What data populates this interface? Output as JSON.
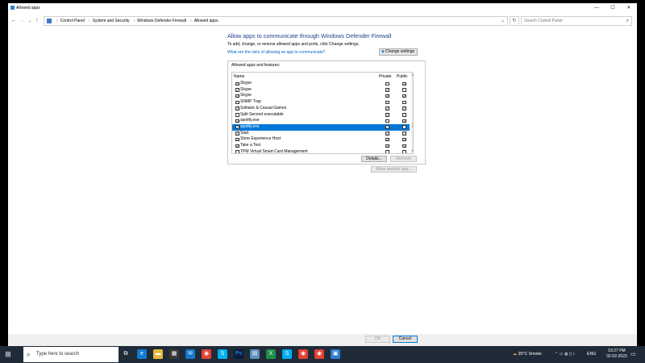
{
  "window": {
    "title": "Allowed apps",
    "minimize": "—",
    "maximize": "☐",
    "close": "✕"
  },
  "address": {
    "breadcrumbs": [
      "Control Panel",
      "Windows Defender Firewall",
      "Allowed apps"
    ],
    "breadcrumb_mid": "System and Security",
    "search_placeholder": "Search Control Panel"
  },
  "main": {
    "heading": "Allow apps to communicate through Windows Defender Firewall",
    "instructions": "To add, change, or remove allowed apps and ports, click Change settings.",
    "risk_link": "What are the risks of allowing an app to communicate?",
    "change_settings": "Change settings",
    "group_title": "Allowed apps and features:",
    "columns": {
      "name": "Name",
      "private": "Private",
      "public": "Public"
    },
    "rows": [
      {
        "name": "Skype",
        "checked": true,
        "private": false,
        "public": true,
        "selected": false
      },
      {
        "name": "Skype",
        "checked": true,
        "private": true,
        "public": false,
        "selected": false
      },
      {
        "name": "Skype",
        "checked": true,
        "private": true,
        "public": true,
        "selected": false
      },
      {
        "name": "SNMP Trap",
        "checked": false,
        "private": false,
        "public": false,
        "selected": false
      },
      {
        "name": "Solitaire & Casual Games",
        "checked": true,
        "private": true,
        "public": true,
        "selected": false
      },
      {
        "name": "Split Second executable",
        "checked": false,
        "private": true,
        "public": false,
        "selected": false
      },
      {
        "name": "spotify.exe",
        "checked": true,
        "private": false,
        "public": true,
        "selected": false
      },
      {
        "name": "spotify.exe",
        "checked": true,
        "private": true,
        "public": false,
        "selected": true
      },
      {
        "name": "Start",
        "checked": true,
        "private": true,
        "public": true,
        "selected": false
      },
      {
        "name": "Store Experience Host",
        "checked": true,
        "private": true,
        "public": true,
        "selected": false
      },
      {
        "name": "Take a Test",
        "checked": true,
        "private": true,
        "public": true,
        "selected": false
      },
      {
        "name": "TPM Virtual Smart Card Management",
        "checked": false,
        "private": false,
        "public": false,
        "selected": false
      }
    ],
    "details": "Details...",
    "remove": "Remove",
    "allow_another": "Allow another app..."
  },
  "footer": {
    "ok": "OK",
    "cancel": "Cancel"
  },
  "taskbar": {
    "search": "Type here to search",
    "weather": "35°C  Smoke",
    "lang": "ENG",
    "time": "03:27 PM",
    "date": "02-02-2023"
  }
}
